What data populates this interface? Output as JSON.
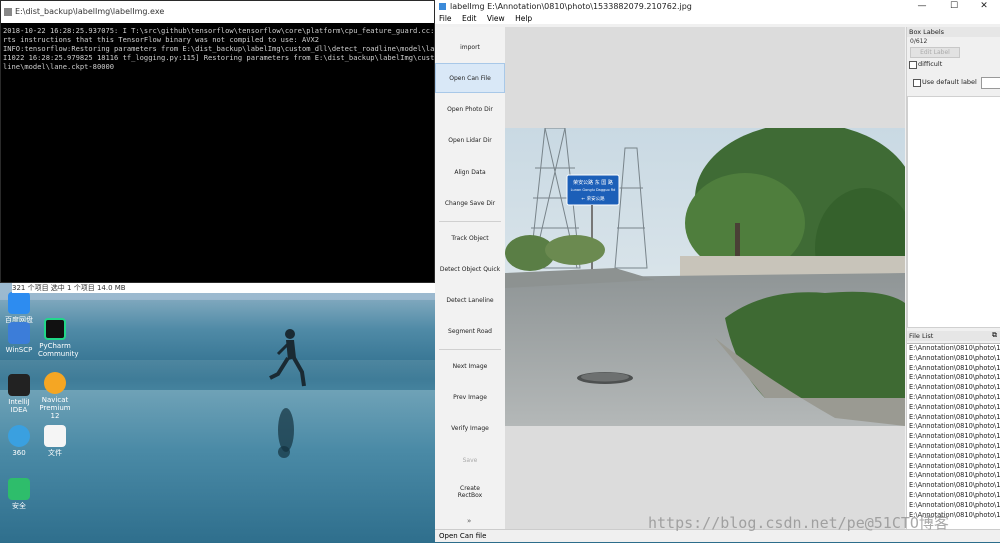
{
  "console": {
    "title": "E:\\dist_backup\\labelImg\\labelImg.exe",
    "lines": [
      "2018-10-22 16:28:25.937075: I T:\\src\\github\\tensorflow\\tensorflow\\core\\platform\\cpu_feature_guard.cc:",
      "rts instructions that this TensorFlow binary was not compiled to use: AVX2",
      "INFO:tensorflow:Restoring parameters from E:\\dist_backup\\labelImg\\custom_dll\\detect_roadline\\model\\la",
      "I1022 16:28:25.979825 18116 tf_logging.py:115] Restoring parameters from E:\\dist_backup\\labelImg\\cust",
      "line\\model\\lane.ckpt-80000"
    ]
  },
  "explorer_status": "321 个项目   选中 1 个项目  14.0 MB",
  "desktop_icons": [
    {
      "label": "百度网盘",
      "color": "#2d8cf0"
    },
    {
      "label": "WinSCP",
      "color": "#3c7dd9"
    },
    {
      "label": "PyCharm Community",
      "color": "#21d789"
    },
    {
      "label": "IntelliJ IDEA",
      "color": "#222222"
    },
    {
      "label": "Navicat Premium 12",
      "color": "#f5a623"
    },
    {
      "label": "360",
      "color": "#3aa0e0"
    },
    {
      "label": "文件",
      "color": "#f5f5f5"
    },
    {
      "label": "安全",
      "color": "#2ebd6b"
    }
  ],
  "app": {
    "title": "labelImg E:\\Annotation\\0810\\photo\\1533882079.210762.jpg",
    "window_buttons": [
      "—",
      "☐",
      "✕"
    ],
    "menu": [
      "File",
      "Edit",
      "View",
      "Help"
    ]
  },
  "toolbar": {
    "items": [
      {
        "label": "import",
        "state": "normal"
      },
      {
        "label": "Open Can File",
        "state": "active"
      },
      {
        "label": "Open Photo Dir",
        "state": "normal"
      },
      {
        "label": "Open Lidar Dir",
        "state": "normal"
      },
      {
        "label": "Align Data",
        "state": "normal"
      },
      {
        "label": "Change Save Dir",
        "state": "normal"
      },
      {
        "label": "Track Object",
        "state": "normal"
      },
      {
        "label": "Detect Object Quick",
        "state": "normal"
      },
      {
        "label": "Detect Laneline",
        "state": "normal"
      },
      {
        "label": "Segment Road",
        "state": "normal"
      },
      {
        "label": "Next Image",
        "state": "normal"
      },
      {
        "label": "Prev Image",
        "state": "normal"
      },
      {
        "label": "Verify Image",
        "state": "normal"
      },
      {
        "label": "Save",
        "state": "disabled"
      },
      {
        "label": "Create RectBox",
        "state": "normal"
      }
    ]
  },
  "dock": {
    "box_labels_title": "Box Labels",
    "box_count": "0/612",
    "edit_label_btn": "Edit Label",
    "difficult_label": "difficult",
    "use_default_label": "Use default label",
    "file_list_title": "File List",
    "file_list_count": 18,
    "file_item_text": "E:\\Annotation\\0810\\photo\\1"
  },
  "sign": {
    "line1": "荣安公路  东 国 路",
    "line2": "Lunan Gonglu  Dagguo Rd",
    "line3": "← 荣安公路"
  },
  "status": {
    "text": "Open Can file"
  },
  "watermark": "https://blog.csdn.net/pe@51CTO博客"
}
